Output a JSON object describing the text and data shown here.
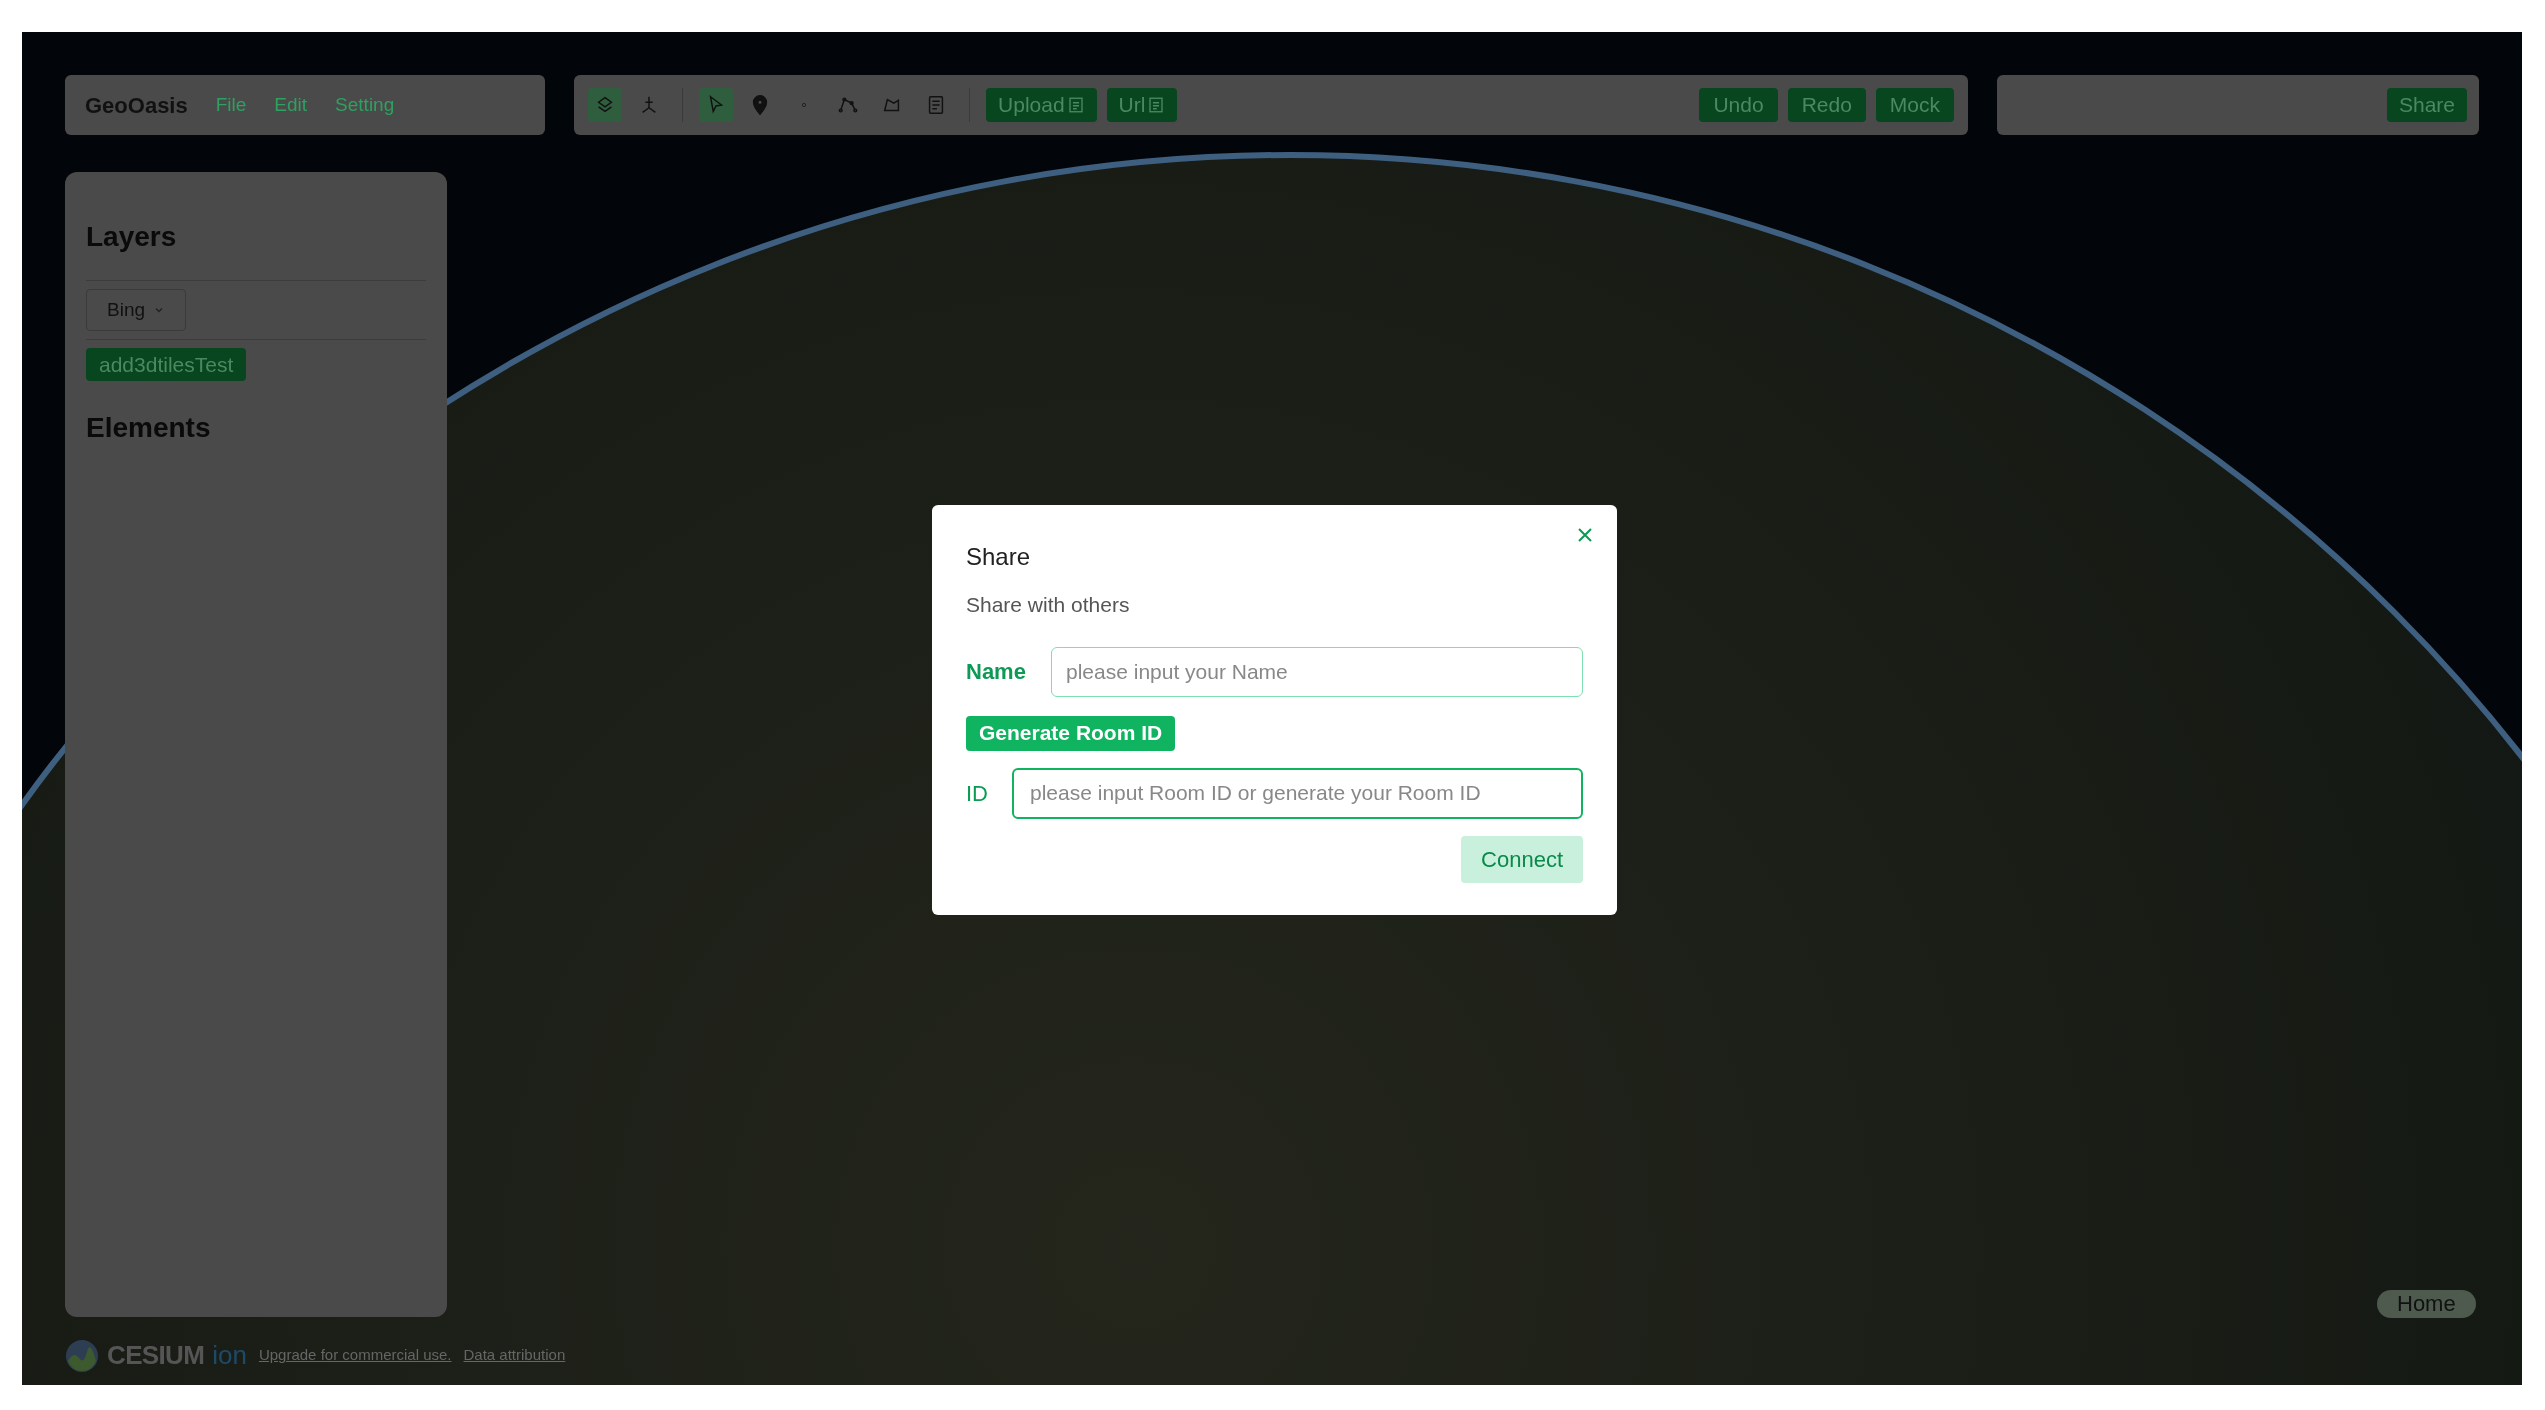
{
  "menu_bar": {
    "app_name": "GeoOasis",
    "items": [
      "File",
      "Edit",
      "Setting"
    ]
  },
  "toolbar": {
    "view_tools": [
      {
        "kind": "terrain",
        "selected": true
      },
      {
        "kind": "axes",
        "selected": false
      }
    ],
    "draw_tools": [
      {
        "kind": "select",
        "selected": true
      },
      {
        "kind": "pin",
        "selected": false
      },
      {
        "kind": "point",
        "selected": false
      },
      {
        "kind": "polyline",
        "selected": false
      },
      {
        "kind": "polygon",
        "selected": false
      },
      {
        "kind": "document",
        "selected": false
      }
    ],
    "file_buttons": [
      "Upload",
      "Url"
    ],
    "history_buttons": [
      "Undo",
      "Redo",
      "Mock"
    ]
  },
  "share_panel": {
    "button": "Share"
  },
  "sidebar": {
    "layers_title": "Layers",
    "basemap": "Bing",
    "layers": [
      "add3dtilesTest"
    ],
    "elements_title": "Elements"
  },
  "dialog": {
    "title": "Share",
    "subtitle": "Share with others",
    "name_label": "Name",
    "name_placeholder": "please input your Name",
    "generate_button": "Generate Room ID",
    "id_label": "ID",
    "id_placeholder": "please input Room ID or generate your Room ID",
    "connect_button": "Connect"
  },
  "home_button": "Home",
  "credits": {
    "logo_text": "CESIUM",
    "logo_suffix": "ion",
    "links": [
      "Upgrade for commercial use.",
      "Data attribution"
    ]
  }
}
